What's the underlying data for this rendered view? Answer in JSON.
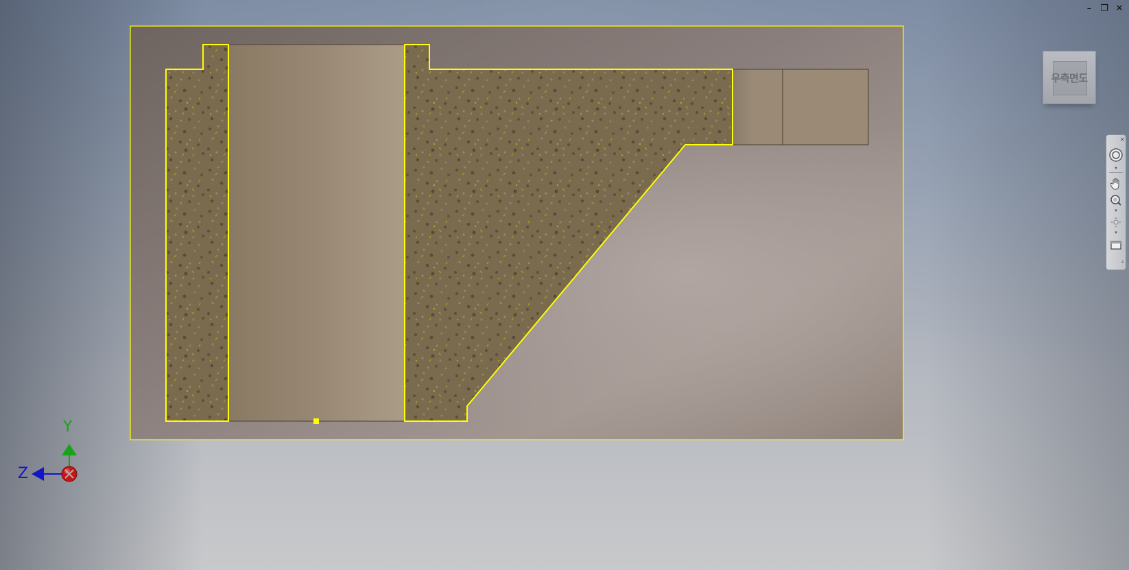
{
  "window_controls": {
    "minimize": "–",
    "restore": "❐",
    "close": "✕"
  },
  "viewcube": {
    "label": "우측면도",
    "icon": "viewcube-icon"
  },
  "nav_bar": {
    "tools": [
      "steering-wheel-icon",
      "pan-icon",
      "zoom-icon",
      "orbit-icon",
      "view-face-icon"
    ]
  },
  "triad": {
    "y_label": "Y",
    "z_label": "Z",
    "y_color": "#1aa31a",
    "z_color": "#1414c8",
    "x_color": "#c81414"
  },
  "colors": {
    "selection": "#ffff00",
    "section_hatch_base": "#7a6a4e",
    "part_face": "#9a8a76",
    "background_top": "#7c8ba3",
    "background_bottom": "#c8c9cb"
  }
}
